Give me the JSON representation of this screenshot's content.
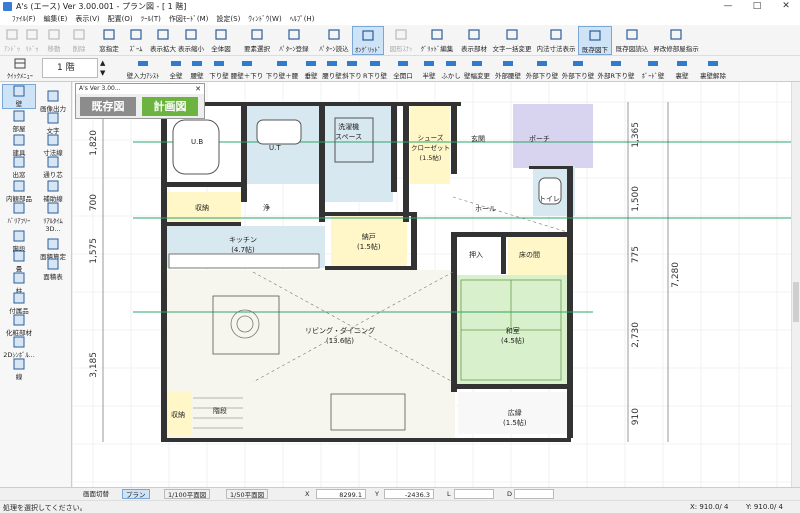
{
  "window": {
    "title": "A's (エース) Ver 3.00.001 - プラン図 - [ 1 階]",
    "minimize": "—",
    "maximize": "□",
    "close": "✕"
  },
  "menu": [
    "ﾌｧｲﾙ(F)",
    "編集(E)",
    "表示(V)",
    "配置(O)",
    "ﾂｰﾙ(T)",
    "作図ﾓｰﾄﾞ(M)",
    "設定(S)",
    "ｳｨﾝﾄﾞｳ(W)",
    "ﾍﾙﾌﾟ(H)"
  ],
  "toolbar1": [
    {
      "label": "ｱﾝﾄﾞｩ",
      "icon": "undo-icon",
      "disabled": true
    },
    {
      "label": "ﾘﾄﾞｩ",
      "icon": "redo-icon",
      "disabled": true
    },
    {
      "label": "移動",
      "icon": "move-icon",
      "disabled": true
    },
    {
      "label": "削除",
      "icon": "eraser-icon",
      "disabled": true
    },
    {
      "label": "窓指定",
      "icon": "window-select-icon"
    },
    {
      "label": "ｽﾞｰﾑ",
      "icon": "zoom-icon"
    },
    {
      "label": "表示拡大",
      "icon": "zoom-in-icon"
    },
    {
      "label": "表示縮小",
      "icon": "zoom-out-icon"
    },
    {
      "label": "全体図",
      "icon": "fit-all-icon"
    },
    {
      "label": "要素選択",
      "icon": "cursor-icon"
    },
    {
      "label": "ﾊﾟﾀｰﾝ登録",
      "icon": "pattern-register-icon"
    },
    {
      "label": "ﾊﾟﾀｰﾝ読込",
      "icon": "pattern-load-icon"
    },
    {
      "label": "ｵﾝｸﾞﾘｯﾄﾞ",
      "icon": "grid-snap-icon",
      "selected": true
    },
    {
      "label": "図形ｽﾅｯﾌﾟ・ｽﾄﾗｯﾌﾟ",
      "icon": "shape-snap-icon",
      "disabled": true
    },
    {
      "label": "ｸﾞﾘｯﾄﾞ編集",
      "icon": "grid-edit-icon"
    },
    {
      "label": "表示部材",
      "icon": "display-parts-icon"
    },
    {
      "label": "文字一括変更",
      "icon": "text-change-icon"
    },
    {
      "label": "内法寸法表示",
      "icon": "inner-dim-icon"
    },
    {
      "label": "既存図下図",
      "icon": "existing-underlay-icon",
      "selected": true
    },
    {
      "label": "既存図読込",
      "icon": "existing-load-icon"
    },
    {
      "label": "昇改修部屋指示",
      "icon": "renovation-room-icon"
    }
  ],
  "toolbar2": {
    "menu_label": "ｸｲｯｸﾒﾆｭｰ",
    "floor": "1 階",
    "items": [
      "壁入力ｱｼｽﾄ",
      "全壁",
      "腰壁",
      "下り壁",
      "腰壁＋下り壁",
      "下り壁＋腰壁",
      "垂壁",
      "腰り壁",
      "斜下り壁",
      "R下り壁",
      "全開口",
      "半壁",
      "ふかし",
      "壁幅変更",
      "外部腰壁",
      "外部下り壁",
      "外部下り壁",
      "外部R下り壁",
      "ﾎﾞｰﾄﾞ壁",
      "裏壁",
      "裏壁解除"
    ]
  },
  "left_panel": [
    {
      "label": "壁",
      "icon": "wall-icon",
      "selected": true
    },
    {
      "label": "画像出力",
      "icon": "image-export-icon"
    },
    {
      "label": "部屋",
      "icon": "room-icon"
    },
    {
      "label": "文字",
      "icon": "text-icon"
    },
    {
      "label": "建具",
      "icon": "fitting-icon"
    },
    {
      "label": "寸法線",
      "icon": "dimension-icon"
    },
    {
      "label": "出窓",
      "icon": "bay-window-icon"
    },
    {
      "label": "通り芯",
      "icon": "axis-line-icon"
    },
    {
      "label": "内観部品",
      "icon": "interior-parts-icon"
    },
    {
      "label": "補助線",
      "icon": "guide-line-icon"
    },
    {
      "label": "ﾊﾞﾘｱﾌﾘｰ",
      "icon": "barrier-free-icon"
    },
    {
      "label": "ﾘｱﾙﾀｲﾑ3D...",
      "icon": "realtime-3d-icon"
    },
    {
      "label": "階段",
      "icon": "stairs-icon"
    },
    {
      "label": "面積算定",
      "icon": "area-calc-icon"
    },
    {
      "label": "畳",
      "icon": "tatami-icon"
    },
    {
      "label": "面積表",
      "icon": "area-table-icon"
    },
    {
      "label": "柱",
      "icon": "pillar-icon"
    },
    {
      "label": "付属品",
      "icon": "accessory-icon"
    },
    {
      "label": "化粧部材",
      "icon": "decor-icon"
    },
    {
      "label": "2Dｼﾝﾎﾞﾙ...",
      "icon": "symbol-2d-icon"
    },
    {
      "label": "線",
      "icon": "line-icon"
    }
  ],
  "float_panel": {
    "title": "A's Ver 3.00...",
    "existing_btn": "既存図",
    "plan_btn": "計画図"
  },
  "rooms": [
    {
      "name": "U.B"
    },
    {
      "name": "U.T"
    },
    {
      "name": "洗濯機\nスペース"
    },
    {
      "name": "シューズ\nクローゼット\n(1.5帖)"
    },
    {
      "name": "玄関"
    },
    {
      "name": "ポーチ"
    },
    {
      "name": "収納"
    },
    {
      "name": "浄"
    },
    {
      "name": "キッチン\n(4.7帖)"
    },
    {
      "name": "納戸\n(1.5帖)"
    },
    {
      "name": "ホール"
    },
    {
      "name": "トイレ"
    },
    {
      "name": "押入"
    },
    {
      "name": "床の間"
    },
    {
      "name": "和室\n(4.5帖)"
    },
    {
      "name": "リビング・ダイニング\n(13.6帖)"
    },
    {
      "name": "収納"
    },
    {
      "name": "階段"
    },
    {
      "name": "広縁\n(1.5帖)"
    }
  ],
  "dims_left": [
    "1,820",
    "700",
    "1,575",
    "3,185"
  ],
  "dims_right": [
    "1,365",
    "1,500",
    "775",
    "2,730",
    "910"
  ],
  "dim_total": "7,280",
  "status_strip": {
    "tab1": "画面切替",
    "tab2": "プラン",
    "tab3": "1/100平面図",
    "tab4": "1/50平面図",
    "x_label": "X",
    "x_value": "8299.1",
    "y_label": "Y",
    "y_value": "-2436.3",
    "l_label": "L",
    "d_label": "D"
  },
  "statusbar": {
    "message": "処理を選択してください。",
    "x": "X: 910.0/ 4",
    "y": "Y: 910.0/ 4"
  }
}
